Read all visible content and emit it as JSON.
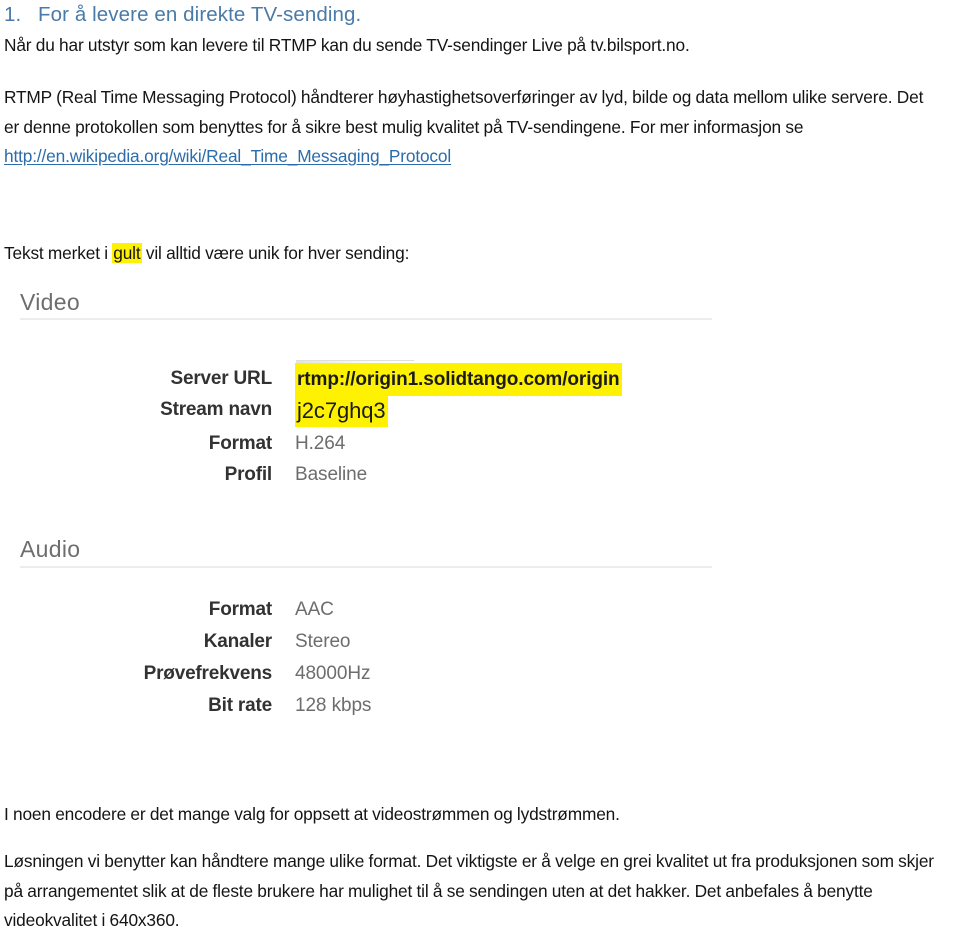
{
  "document": {
    "heading": {
      "number": "1.",
      "text": "For å levere en direkte TV-sending.",
      "color": "#4a7aa7"
    },
    "paragraphs": {
      "intro": "Når du har utstyr som kan levere til RTMP kan du sende TV-sendinger Live på tv.bilsport.no.",
      "rtmp_part1": "RTMP (Real Time Messaging Protocol) håndterer høyhastighetsoverføringer av lyd, bilde og data mellom ulike servere. Det er denne protokollen som benyttes for å sikre best mulig kvalitet på TV-sendingene. For mer informasjon se ",
      "rtmp_link": "http://en.wikipedia.org/wiki/Real_Time_Messaging_Protocol",
      "gult_before": "Tekst merket i ",
      "gult_highlight": "gult",
      "gult_after": " vil alltid være unik for hver sending:",
      "bottom1": "I noen encodere er det mange valg for oppsett at videostrømmen og lydstrømmen.",
      "bottom2": "Løsningen vi benytter kan håndtere mange ulike format. Det viktigste er å velge en grei kvalitet ut fra produksjonen som skjer på arrangementet slik at de fleste brukere har mulighet til å se sendingen uten at det hakker. Det anbefales å benytte videokvalitet i 640x360."
    },
    "highlight_color": "#fff200",
    "link_color": "#2b6cab"
  },
  "screenshot": {
    "video": {
      "title": "Video",
      "rows": [
        {
          "label": "Server URL",
          "value": "rtmp://origin1.solidtango.com/origin",
          "highlighted": true,
          "strong": true
        },
        {
          "label": "Stream navn",
          "value": "j2c7ghq3",
          "highlighted": true,
          "strong": false
        },
        {
          "label": "Format",
          "value": "H.264",
          "highlighted": false,
          "strong": false
        },
        {
          "label": "Profil",
          "value": "Baseline",
          "highlighted": false,
          "strong": false
        }
      ]
    },
    "audio": {
      "title": "Audio",
      "rows": [
        {
          "label": "Format",
          "value": "AAC"
        },
        {
          "label": "Kanaler",
          "value": "Stereo"
        },
        {
          "label": "Prøvefrekvens",
          "value": "48000Hz"
        },
        {
          "label": "Bit rate",
          "value": "128 kbps"
        }
      ]
    }
  }
}
